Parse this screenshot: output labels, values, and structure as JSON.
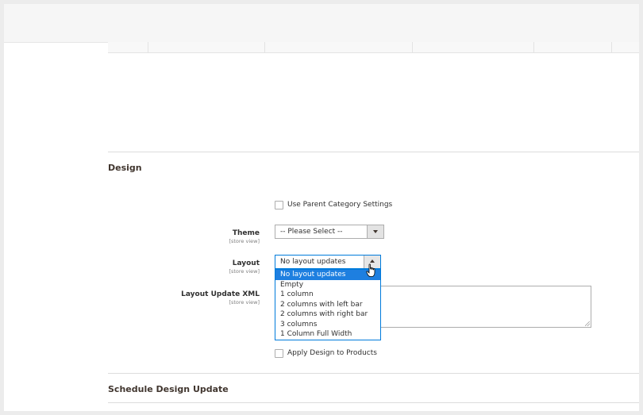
{
  "design": {
    "title": "Design",
    "use_parent_label": "Use Parent Category Settings",
    "theme": {
      "label": "Theme",
      "scope": "[store view]",
      "value": "-- Please Select --"
    },
    "layout": {
      "label": "Layout",
      "scope": "[store view]",
      "value": "No layout updates",
      "options": [
        "No layout updates",
        "Empty",
        "1 column",
        "2 columns with left bar",
        "2 columns with right bar",
        "3 columns",
        "1 Column Full Width"
      ],
      "selected_index": 0
    },
    "layout_update_xml": {
      "label": "Layout Update XML",
      "scope": "[store view]",
      "value": ""
    },
    "apply_to_products_label": "Apply Design to Products"
  },
  "schedule": {
    "title": "Schedule Design Update"
  },
  "colors": {
    "accent": "#007bdb",
    "selected_option": "#1e7fe0"
  }
}
